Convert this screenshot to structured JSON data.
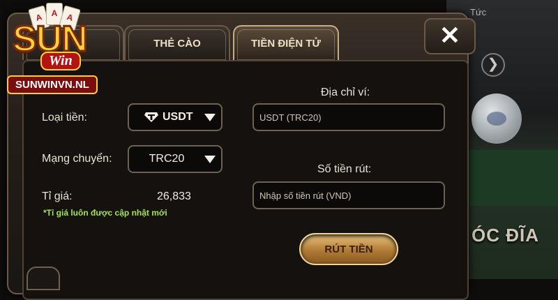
{
  "background": {
    "tab_text": "Tức",
    "arrow": "❯",
    "game_title": "ÓC ĐĨA"
  },
  "logo": {
    "brand": "SUN",
    "sub": "Win",
    "url": "SUNWINVN.NL",
    "cards": [
      "A",
      "A",
      "A"
    ]
  },
  "tabs": [
    {
      "label": "",
      "active": false
    },
    {
      "label": "THẺ CÀO",
      "active": false
    },
    {
      "label": "TIỀN ĐIỆN TỬ",
      "active": true
    }
  ],
  "close_icon": "✕",
  "form": {
    "currency_label": "Loại tiền:",
    "currency_value": "USDT",
    "currency_icon": "tether-icon",
    "network_label": "Mạng chuyển:",
    "network_value": "TRC20",
    "rate_label": "Tỉ giá:",
    "rate_value": "26,833",
    "rate_note": "*Tỉ giá luôn được cập nhật mới",
    "wallet_label": "Địa chỉ ví:",
    "wallet_placeholder": "USDT (TRC20)",
    "amount_label": "Số tiền rút:",
    "amount_placeholder": "Nhập số tiền rút (VND)",
    "submit_label": "RÚT TIỀN"
  },
  "colors": {
    "accent_gold": "#e8c27e",
    "note_green": "#a6e34a",
    "tether": "#f2efe9"
  }
}
